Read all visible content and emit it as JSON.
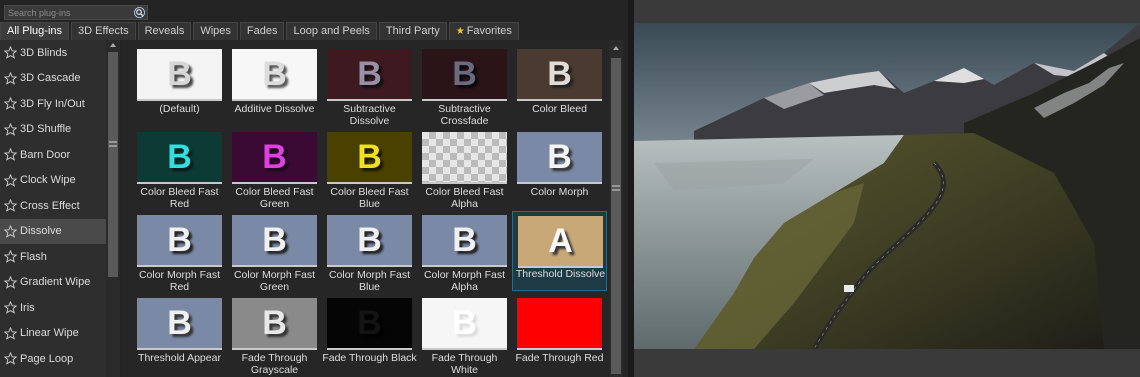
{
  "search": {
    "placeholder": "Search plug-ins",
    "value": ""
  },
  "tabs": [
    {
      "label": "All Plug-ins",
      "active": true
    },
    {
      "label": "3D Effects",
      "active": false
    },
    {
      "label": "Reveals",
      "active": false
    },
    {
      "label": "Wipes",
      "active": false
    },
    {
      "label": "Fades",
      "active": false
    },
    {
      "label": "Loop and Peels",
      "active": false
    },
    {
      "label": "Third Party",
      "active": false
    },
    {
      "label": "Favorites",
      "active": false,
      "icon": "star-icon"
    }
  ],
  "categories": [
    {
      "label": "3D Blinds"
    },
    {
      "label": "3D Cascade"
    },
    {
      "label": "3D Fly In/Out"
    },
    {
      "label": "3D Shuffle"
    },
    {
      "label": "Barn Door"
    },
    {
      "label": "Clock Wipe"
    },
    {
      "label": "Cross Effect"
    },
    {
      "label": "Dissolve",
      "selected": true
    },
    {
      "label": "Flash"
    },
    {
      "label": "Gradient Wipe"
    },
    {
      "label": "Iris"
    },
    {
      "label": "Linear Wipe"
    },
    {
      "label": "Page Loop"
    }
  ],
  "presets": [
    {
      "label": "(Default)",
      "bg": "#f4f4f4",
      "fg": "#d6d6d6",
      "shadow": "#444"
    },
    {
      "label": "Additive Dissolve",
      "bg": "#f7f7f7",
      "fg": "#dddddd",
      "shadow": "#555"
    },
    {
      "label": "Subtractive Dissolve",
      "bg": "#3e1a20",
      "fg": "#9a8fa8",
      "shadow": "#111"
    },
    {
      "label": "Subtractive Crossfade",
      "bg": "#2a1418",
      "fg": "#6a6a80",
      "shadow": "#0a0a0a"
    },
    {
      "label": "Color Bleed",
      "bg": "#4a3a30",
      "fg": "#e0dcd8",
      "shadow": "#222"
    },
    {
      "label": "Color Bleed Fast Red",
      "bg": "#0d3a34",
      "fg": "#30e0e0",
      "shadow": "#0a1a1a"
    },
    {
      "label": "Color Bleed Fast Green",
      "bg": "#3a0a34",
      "fg": "#e040e0",
      "shadow": "#1a0a1a"
    },
    {
      "label": "Color Bleed Fast Blue",
      "bg": "#4a4000",
      "fg": "#f0e020",
      "shadow": "#1a1600"
    },
    {
      "label": "Color Bleed Fast Alpha",
      "bg": "checker",
      "fg": "transparent",
      "shadow": "transparent"
    },
    {
      "label": "Color Morph",
      "bg": "#7a8aa6",
      "fg": "#f4f4f4",
      "shadow": "#333"
    },
    {
      "label": "Color Morph Fast Red",
      "bg": "#7a8aa6",
      "fg": "#f0f0f0",
      "shadow": "#222"
    },
    {
      "label": "Color Morph Fast Green",
      "bg": "#7a8aa6",
      "fg": "#f0f0f0",
      "shadow": "#222"
    },
    {
      "label": "Color Morph Fast Blue",
      "bg": "#7a8aa6",
      "fg": "#f0f0f0",
      "shadow": "#222"
    },
    {
      "label": "Color Morph Fast Alpha",
      "bg": "#7a8aa6",
      "fg": "#f0f0f0",
      "shadow": "#222"
    },
    {
      "label": "Threshold Dissolve",
      "bg": "#c9a878",
      "fg": "#f8f8f8",
      "shadow": "#333",
      "selected": true
    },
    {
      "label": "Threshold Appear",
      "bg": "#7a8aa6",
      "fg": "#f0f0f0",
      "shadow": "#333"
    },
    {
      "label": "Fade Through Grayscale",
      "bg": "#8a8a8a",
      "fg": "#e8e8e8",
      "shadow": "#333"
    },
    {
      "label": "Fade Through Black",
      "bg": "#050505",
      "fg": "#141414",
      "shadow": "#000"
    },
    {
      "label": "Fade Through White",
      "bg": "#f6f6f6",
      "fg": "#ffffff",
      "shadow": "#ddd"
    },
    {
      "label": "Fade Through Red",
      "bg": "#ff0000",
      "fg": "#ff0000",
      "shadow": "#ff0000"
    }
  ],
  "preview": {
    "image_icon": "landscape-preview-image"
  }
}
